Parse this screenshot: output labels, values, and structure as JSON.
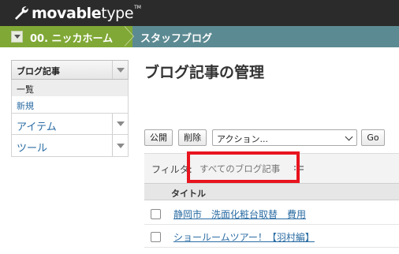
{
  "brand": {
    "name_bold": "movable",
    "name_light": "type",
    "tm": "TM"
  },
  "breadcrumb": {
    "site": "00. ニッカホーム",
    "blog": "スタッフブログ"
  },
  "menu": {
    "section_title": "ブログ記事",
    "sub_items": [
      "一覧",
      "新規"
    ],
    "items": [
      "アイテム",
      "ツール"
    ]
  },
  "main": {
    "title": "ブログ記事の管理",
    "buttons": {
      "publish": "公開",
      "delete": "削除",
      "go": "Go"
    },
    "action_select": "アクション...",
    "filter": {
      "label": "フィルタ:",
      "value": "すべてのブログ記事"
    },
    "table": {
      "header_title": "タイトル",
      "rows": [
        "静岡市　洗面化粧台取替　費用",
        "ショールームツアー！【羽村編】"
      ]
    }
  },
  "colors": {
    "brandbar": "#2b2b2b",
    "site_crumb": "#80a836",
    "blog_crumb": "#5c8a92",
    "link": "#2b6ca3",
    "highlight": "#e8141e"
  }
}
